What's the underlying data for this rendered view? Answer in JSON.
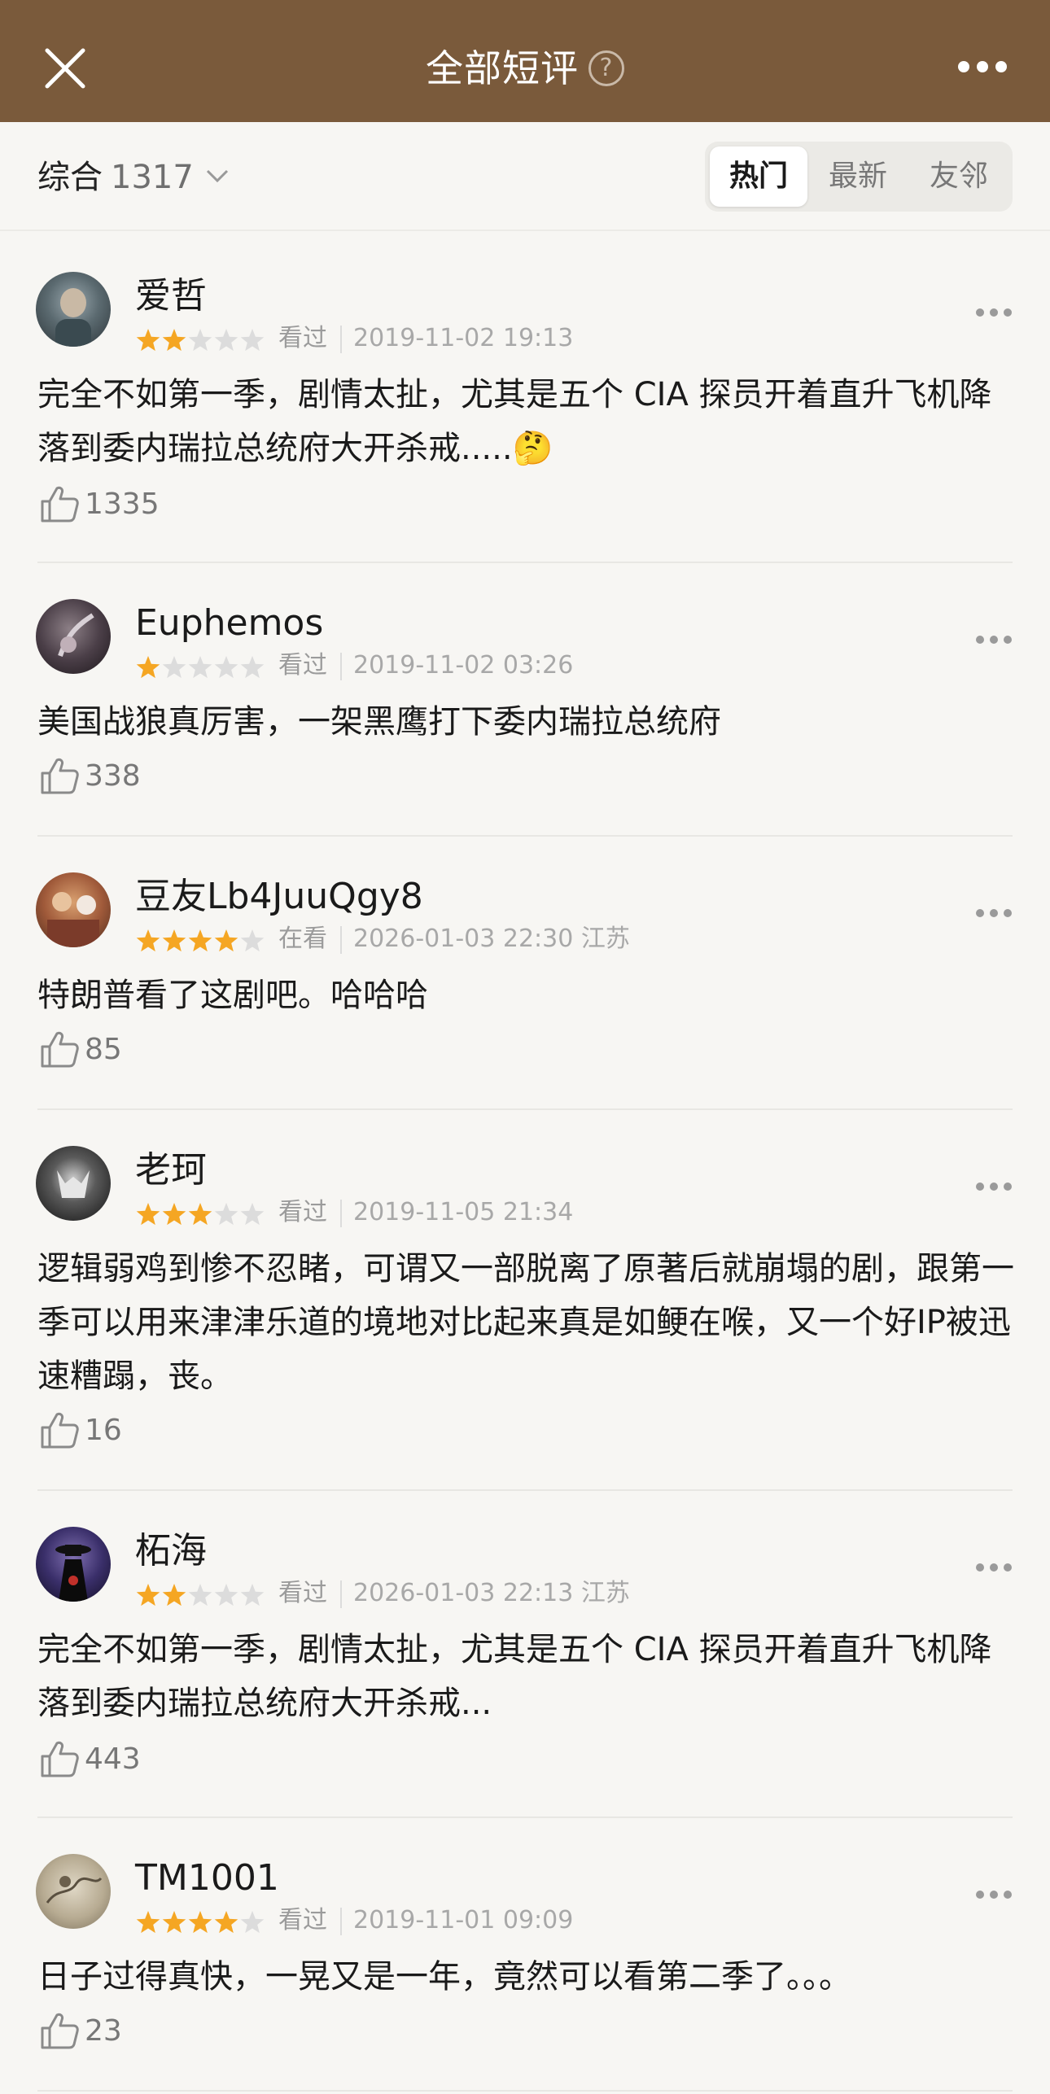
{
  "header": {
    "title": "全部短评",
    "help_symbol": "?"
  },
  "filter": {
    "sort_label": "综合",
    "count": "1317",
    "tabs": [
      {
        "label": "热门",
        "active": true
      },
      {
        "label": "最新",
        "active": false
      },
      {
        "label": "友邻",
        "active": false
      }
    ]
  },
  "colors": {
    "header_bg": "#7a5a3b",
    "star_on": "#f5a623",
    "star_off": "#dcdcdc"
  },
  "reviews": [
    {
      "user": "爱哲",
      "rating": 2,
      "status": "看过",
      "time": "2019-11-02 19:13",
      "text": "完全不如第一季，剧情太扯，尤其是五个 CIA 探员开着直升飞机降落到委内瑞拉总统府大开杀戒.....🤔",
      "likes": "1335"
    },
    {
      "user": "Euphemos",
      "rating": 1,
      "status": "看过",
      "time": "2019-11-02 03:26",
      "text": "美国战狼真厉害，一架黑鹰打下委内瑞拉总统府",
      "likes": "338"
    },
    {
      "user": "豆友Lb4JuuQgy8",
      "rating": 4,
      "status": "在看",
      "time": "2026-01-03 22:30 江苏",
      "text": "特朗普看了这剧吧。哈哈哈",
      "likes": "85"
    },
    {
      "user": "老珂",
      "rating": 3,
      "status": "看过",
      "time": "2019-11-05 21:34",
      "text": "逻辑弱鸡到惨不忍睹，可谓又一部脱离了原著后就崩塌的剧，跟第一季可以用来津津乐道的境地对比起来真是如鲠在喉，又一个好IP被迅速糟蹋，丧。",
      "likes": "16"
    },
    {
      "user": "柘海",
      "rating": 2,
      "status": "看过",
      "time": "2026-01-03 22:13 江苏",
      "text": "完全不如第一季，剧情太扯，尤其是五个 CIA 探员开着直升飞机降落到委内瑞拉总统府大开杀戒...",
      "likes": "443"
    },
    {
      "user": "TM1001",
      "rating": 4,
      "status": "看过",
      "time": "2019-11-01 09:09",
      "text": "日子过得真快，一晃又是一年，竟然可以看第二季了。。。",
      "likes": "23"
    }
  ]
}
